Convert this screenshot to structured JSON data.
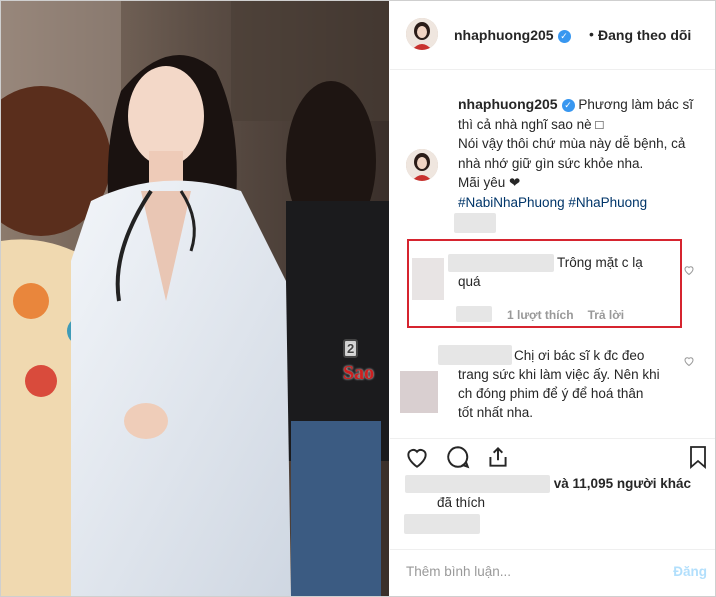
{
  "header": {
    "username": "nhaphuong205",
    "dot": "•",
    "follow_status": "Đang theo dõi"
  },
  "caption": {
    "username": "nhaphuong205",
    "line1": "Phương làm bác sĩ",
    "line2": "thì cả nhà nghĩ sao nè □",
    "line3": "Nói vậy thôi chứ mùa này dễ bệnh, cả",
    "line4": "nhà nhớ giữ gìn sức khỏe nha.",
    "line5": "Mãi yêu ❤",
    "hashtag1": "#NabiNhaPhuong",
    "hashtag2": "#NhaPhuong"
  },
  "comments": [
    {
      "text_line1": "Trông mặt c lạ",
      "text_line2": "quá",
      "likes": "1 lượt thích",
      "reply": "Trả lời"
    },
    {
      "text_line1": "Chị ơi bác sĩ k đc đeo",
      "text_line2": "trang sức khi làm việc ấy. Nên khi",
      "text_line3": "ch đóng phim để ý để hoá thân",
      "text_line4": "tốt nhất nha."
    }
  ],
  "likes_section": {
    "others": "và 11,095 người khác",
    "liked": "đã thích"
  },
  "add_comment": {
    "placeholder": "Thêm bình luận...",
    "post_label": "Đăng"
  },
  "watermark": {
    "number": "2",
    "brand": "Sao"
  },
  "colors": {
    "highlight_border": "#d6242f",
    "verified_badge": "#3897f0",
    "hashtag": "#003569",
    "post_disabled": "#b2dffc"
  },
  "icons": [
    "verified-icon",
    "heart-icon",
    "comment-icon",
    "share-icon",
    "bookmark-icon"
  ]
}
